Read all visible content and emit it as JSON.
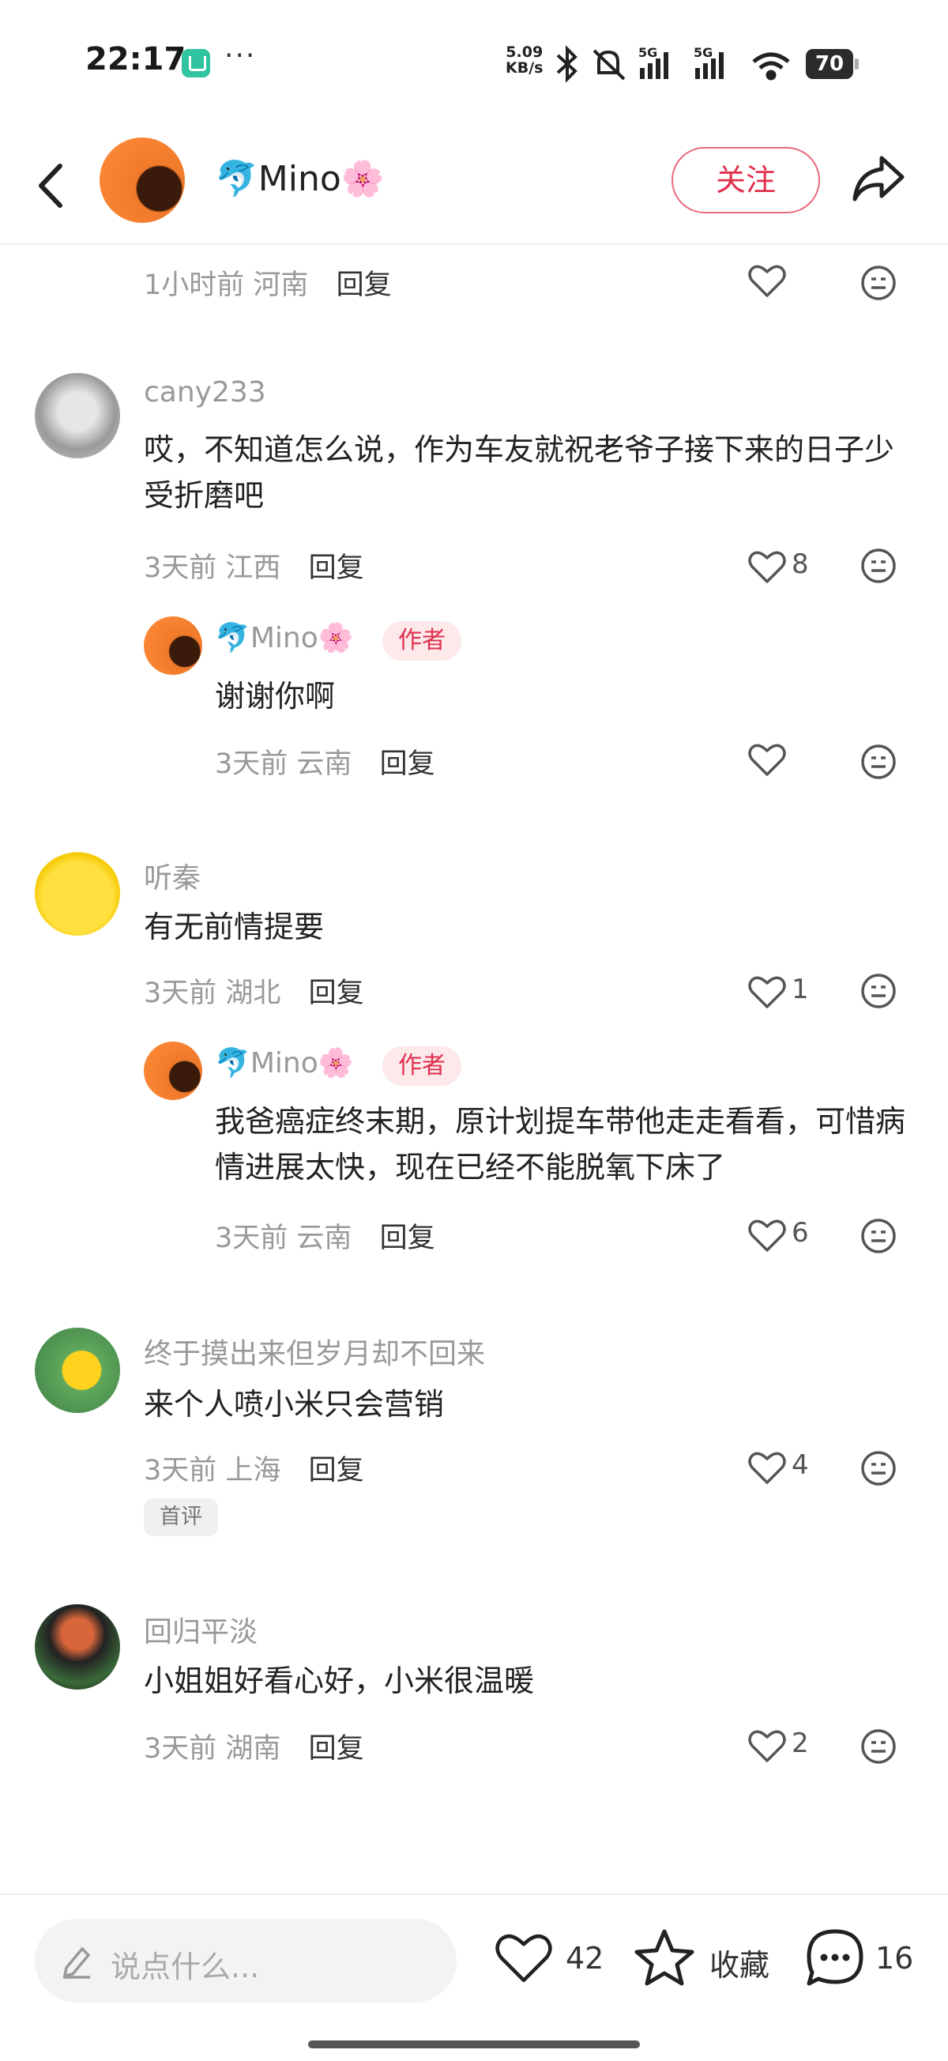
{
  "status_bar": {
    "time": "22:17",
    "net_speed_value": "5.09",
    "net_speed_unit": "KB/s",
    "signal_1": "5G",
    "signal_2": "5G",
    "battery": "70"
  },
  "header": {
    "name": "🐬Mino🌸",
    "follow_label": "关注"
  },
  "comments": {
    "top_meta": {
      "time": "1小时前",
      "location": "河南",
      "reply": "回复"
    },
    "c1": {
      "user": "cany233",
      "text": "哎，不知道怎么说，作为车友就祝老爷子接下来的日子少受折磨吧",
      "time": "3天前",
      "location": "江西",
      "reply": "回复",
      "likes": "8",
      "reply_item": {
        "user": "🐬Mino🌸",
        "tag": "作者",
        "text": "谢谢你啊",
        "time": "3天前",
        "location": "云南",
        "reply": "回复"
      }
    },
    "c2": {
      "user": "听秦",
      "text": "有无前情提要",
      "time": "3天前",
      "location": "湖北",
      "reply": "回复",
      "likes": "1",
      "reply_item": {
        "user": "🐬Mino🌸",
        "tag": "作者",
        "text": "我爸癌症终末期，原计划提车带他走走看看，可惜病情进展太快，现在已经不能脱氧下床了",
        "time": "3天前",
        "location": "云南",
        "reply": "回复",
        "likes": "6"
      }
    },
    "c3": {
      "user": "终于摸出来但岁月却不回来",
      "text": "来个人喷小米只会营销",
      "time": "3天前",
      "location": "上海",
      "reply": "回复",
      "likes": "4",
      "badge": "首评"
    },
    "c4": {
      "user": "回归平淡",
      "text": "小姐姐好看心好，小米很温暖",
      "time": "3天前",
      "location": "湖南",
      "reply": "回复",
      "likes": "2"
    }
  },
  "bottom_bar": {
    "input_placeholder": "说点什么...",
    "like_count": "42",
    "favorite_label": "收藏",
    "comment_count": "16"
  },
  "colors": {
    "accent": "#e0304e",
    "muted": "#999999"
  }
}
